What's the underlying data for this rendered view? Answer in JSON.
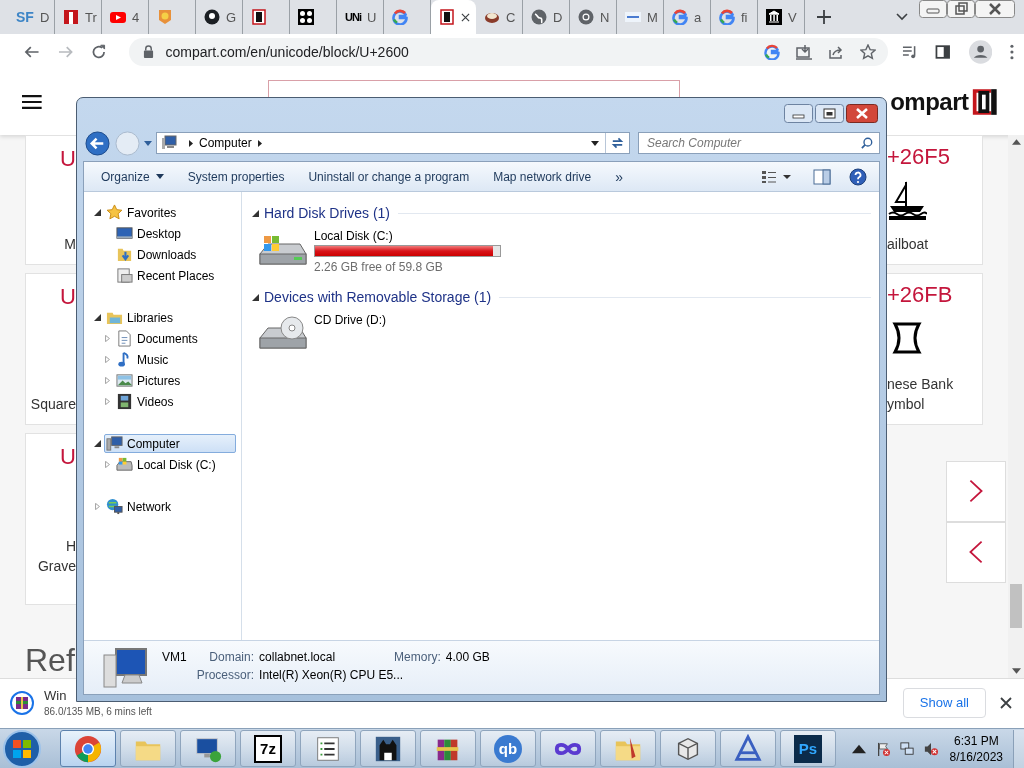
{
  "browser": {
    "tabs": [
      {
        "kind": "sf",
        "icon_text": "SF",
        "label": "D",
        "selected": false
      },
      {
        "kind": "bars",
        "label": "Tr",
        "selected": false
      },
      {
        "kind": "play",
        "label": "4",
        "selected": false
      },
      {
        "kind": "face",
        "selected": false
      },
      {
        "kind": "round",
        "label": "G",
        "selected": false
      },
      {
        "kind": "bracket",
        "selected": false
      },
      {
        "kind": "pattern",
        "selected": false
      },
      {
        "kind": "letters",
        "icon_text": "UNi",
        "label": "U",
        "selected": false
      },
      {
        "kind": "ring",
        "selected": false
      },
      {
        "kind": "bracket",
        "selected": true
      },
      {
        "kind": "bowl",
        "label": "C",
        "selected": false
      },
      {
        "kind": "globe",
        "label": "D",
        "selected": false
      },
      {
        "kind": "wheel",
        "label": "N",
        "selected": false
      },
      {
        "kind": "banner",
        "label": "M",
        "selected": false
      },
      {
        "kind": "ring",
        "label": "a",
        "selected": false
      },
      {
        "kind": "ring",
        "label": "fi",
        "selected": false
      },
      {
        "kind": "pillars",
        "label": "V",
        "selected": false
      }
    ],
    "address": "compart.com/en/unicode/block/U+2600"
  },
  "page": {
    "logo": "ompart",
    "left_cards": [
      {
        "code": "U",
        "name": [
          "M"
        ]
      },
      {
        "code": "U",
        "name": [
          "Square"
        ]
      },
      {
        "code": "U",
        "name": [
          "H",
          "Grave"
        ]
      }
    ],
    "right_cards": [
      {
        "code": "+26F5",
        "kind": "sailboat",
        "name": [
          "ailboat"
        ]
      },
      {
        "code": "+26FB",
        "kind": "bank",
        "name": [
          "nese Bank",
          "ymbol"
        ]
      }
    ],
    "heading": "Ref"
  },
  "explorer": {
    "nav": {
      "location": "Computer",
      "search_placeholder": "Search Computer"
    },
    "toolbar": [
      {
        "label": "Organize",
        "menu": true
      },
      {
        "label": "System properties",
        "menu": false
      },
      {
        "label": "Uninstall or change a program",
        "menu": false
      },
      {
        "label": "Map network drive",
        "menu": false
      }
    ],
    "toolbar_more": "»",
    "tree": [
      {
        "label": "Favorites",
        "kind": "star",
        "expanded": true,
        "selected": false,
        "children": [
          {
            "label": "Desktop",
            "kind": "desktop",
            "selected": false
          },
          {
            "label": "Downloads",
            "kind": "downloads",
            "selected": false
          },
          {
            "label": "Recent Places",
            "kind": "recent",
            "selected": false
          }
        ]
      },
      {
        "label": "Libraries",
        "kind": "library",
        "expanded": true,
        "selected": false,
        "children": [
          {
            "label": "Documents",
            "kind": "document",
            "expanded": false,
            "selected": false
          },
          {
            "label": "Music",
            "kind": "music",
            "expanded": false,
            "selected": false
          },
          {
            "label": "Pictures",
            "kind": "pictures",
            "expanded": false,
            "selected": false
          },
          {
            "label": "Videos",
            "kind": "videos",
            "expanded": false,
            "selected": false
          }
        ]
      },
      {
        "label": "Computer",
        "kind": "computer",
        "expanded": true,
        "selected": true,
        "children": [
          {
            "label": "Local Disk (C:)",
            "kind": "drive",
            "expanded": false,
            "selected": false
          }
        ]
      },
      {
        "label": "Network",
        "kind": "network",
        "expanded": false,
        "selected": false
      }
    ],
    "groups": [
      {
        "title": "Hard Disk Drives (1)",
        "expanded": true,
        "items": [
          {
            "kind": "hdd",
            "name": "Local Disk (C:)",
            "level": 0.96,
            "free": "2.26 GB free of 59.8 GB"
          }
        ]
      },
      {
        "title": "Devices with Removable Storage (1)",
        "expanded": true,
        "items": [
          {
            "kind": "cd",
            "name": "CD Drive (D:)"
          }
        ]
      }
    ],
    "details": {
      "name": "VM1",
      "fields": [
        {
          "label": "Domain:",
          "value": "collabnet.local"
        },
        {
          "label": "Memory:",
          "value": "4.00 GB"
        },
        {
          "label": "Processor:",
          "value": "Intel(R) Xeon(R) CPU E5..."
        }
      ]
    }
  },
  "downloads": {
    "items": [
      {
        "name": "Win",
        "status": "86.0/135 MB, 6 mins left"
      }
    ],
    "show_all": "Show all"
  },
  "taskbar": {
    "apps": [
      {
        "kind": "chrome",
        "selected": true
      },
      {
        "kind": "folder",
        "selected": false
      },
      {
        "kind": "remote",
        "selected": false
      },
      {
        "kind": "sevenzip",
        "label": "7z",
        "selected": false
      },
      {
        "kind": "list",
        "selected": false
      },
      {
        "kind": "cat",
        "selected": false
      },
      {
        "kind": "archive",
        "selected": false
      },
      {
        "kind": "qb",
        "label": "qb",
        "selected": false
      },
      {
        "kind": "infinity",
        "selected": false
      },
      {
        "kind": "penfolder",
        "selected": false
      },
      {
        "kind": "box",
        "selected": false
      },
      {
        "kind": "triangle",
        "selected": false
      },
      {
        "kind": "ps",
        "label": "Ps",
        "selected": false
      }
    ],
    "time": "6:31 PM",
    "date": "8/16/2023"
  }
}
